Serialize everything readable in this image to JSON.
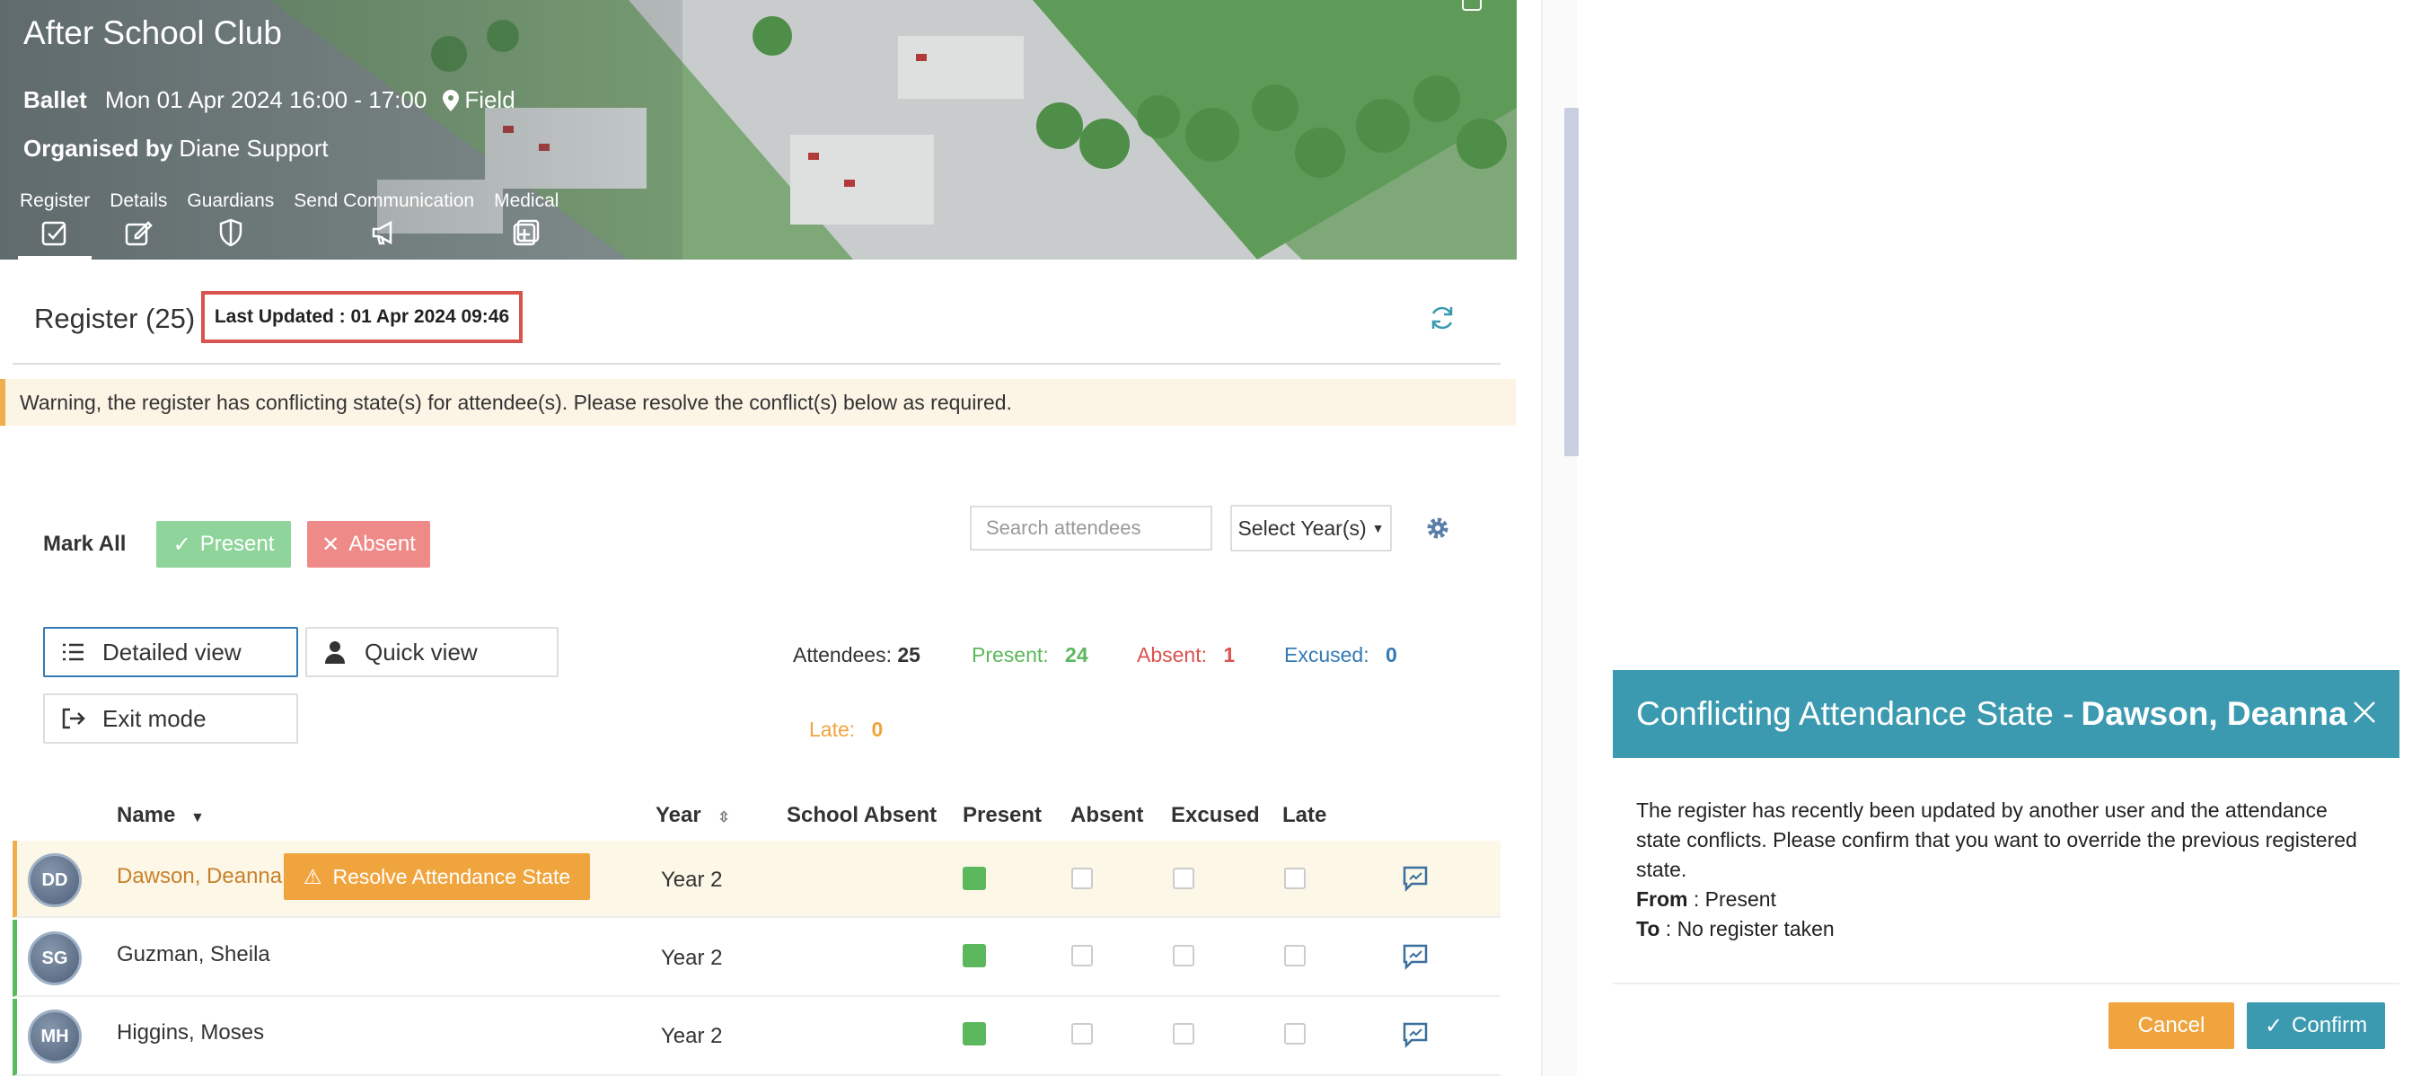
{
  "header": {
    "title": "After School Club",
    "activity": "Ballet",
    "datetime": "Mon 01 Apr 2024 16:00 - 17:00",
    "location": "Field",
    "organiser_prefix": "Organised by",
    "organiser_name": "Diane Support",
    "tabs": [
      {
        "label": "Register",
        "icon": "checkbox-icon",
        "active": true
      },
      {
        "label": "Details",
        "icon": "edit-icon",
        "active": false
      },
      {
        "label": "Guardians",
        "icon": "shield-icon",
        "active": false
      },
      {
        "label": "Send Communication",
        "icon": "megaphone-icon",
        "active": false
      },
      {
        "label": "Medical",
        "icon": "medical-icon",
        "active": false
      }
    ]
  },
  "register": {
    "title": "Register (25)",
    "last_updated": "Last Updated :  01 Apr 2024 09:46",
    "warning": "Warning, the register has conflicting state(s) for attendee(s). Please resolve the conflict(s) below as required."
  },
  "mark_all": {
    "label": "Mark All",
    "present": "Present",
    "absent": "Absent"
  },
  "search": {
    "placeholder": "Search attendees"
  },
  "year_select": {
    "label": "Select Year(s)"
  },
  "views": {
    "detailed": "Detailed view",
    "quick": "Quick view",
    "exit": "Exit mode"
  },
  "stats": {
    "attendees_label": "Attendees:",
    "attendees": "25",
    "present_label": "Present:",
    "present": "24",
    "absent_label": "Absent:",
    "absent": "1",
    "excused_label": "Excused:",
    "excused": "0",
    "late_label": "Late:",
    "late": "0"
  },
  "table": {
    "headers": {
      "name": "Name",
      "year": "Year",
      "school_absent": "School Absent",
      "present": "Present",
      "absent": "Absent",
      "excused": "Excused",
      "late": "Late"
    },
    "resolve_label": "Resolve Attendance State",
    "rows": [
      {
        "initials": "DD",
        "name": "Dawson, Deanna",
        "year": "Year 2",
        "present": true
      },
      {
        "initials": "SG",
        "name": "Guzman, Sheila",
        "year": "Year 2",
        "present": true
      },
      {
        "initials": "MH",
        "name": "Higgins, Moses",
        "year": "Year 2",
        "present": true
      }
    ]
  },
  "modal": {
    "title_prefix": "Conflicting Attendance State -",
    "title_name": "Dawson, Deanna",
    "body": "The register has recently been updated by another user and the attendance state conflicts. Please confirm that you want to override the previous registered state.",
    "from_label": "From",
    "from_value": ": Present",
    "to_label": "To",
    "to_value": ": No register taken",
    "cancel": "Cancel",
    "confirm": "Confirm"
  },
  "colors": {
    "accent": "#3b9ab0",
    "warning": "#f0a43e",
    "present": "#5cb85c",
    "absent": "#d9534f",
    "excused": "#337ab7"
  }
}
